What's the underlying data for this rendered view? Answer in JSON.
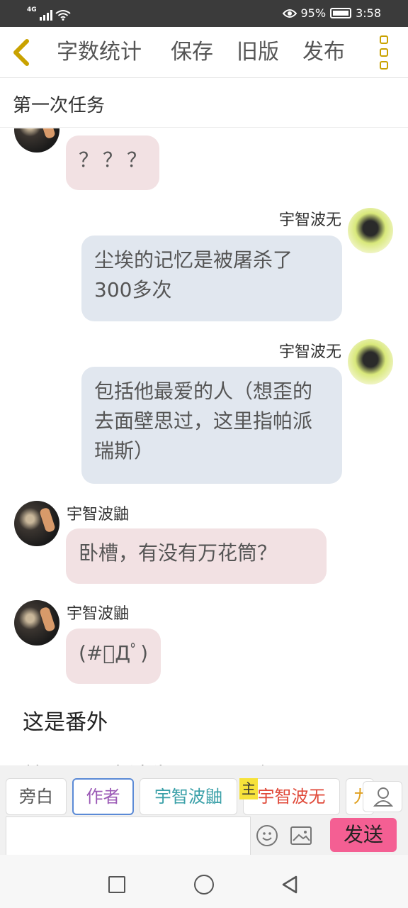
{
  "status": {
    "network": "4G",
    "battery": "95%",
    "time": "3:58"
  },
  "toolbar": {
    "word_count": "字数统计",
    "save": "保存",
    "old_version": "旧版",
    "publish": "发布"
  },
  "page_title": "第一次任务",
  "messages": [
    {
      "side": "left",
      "name": "",
      "text": "？？？"
    },
    {
      "side": "right",
      "name": "宇智波无",
      "text": "尘埃的记忆是被屠杀了300多次"
    },
    {
      "side": "right",
      "name": "宇智波无",
      "text": "包括他最爱的人（想歪的去面壁思过，这里指帕派瑞斯）"
    },
    {
      "side": "left",
      "name": "宇智波鼬",
      "text": "卧槽，有没有万花筒？"
    },
    {
      "side": "left",
      "name": "宇智波鼬",
      "text": "(#ﾟДﾟ)"
    }
  ],
  "narration": {
    "line1": "这是番外",
    "line2": "就是一切占消失可以不二年五"
  },
  "roles": {
    "aside": "旁白",
    "author": "作者",
    "char1": "宇智波鼬",
    "main_tag": "主",
    "char2": "宇智波无",
    "char3": "九",
    "colors": {
      "aside": "#555555",
      "author": "#9b59b6",
      "char1": "#3aa0a8",
      "char2": "#e04a3a"
    }
  },
  "composer": {
    "placeholder": "",
    "send": "发送"
  },
  "icons": [
    "back-chevron-icon",
    "more-vert-icon",
    "person-icon",
    "emoji-icon",
    "image-icon",
    "nav-square-icon",
    "nav-circle-icon",
    "nav-back-icon"
  ]
}
